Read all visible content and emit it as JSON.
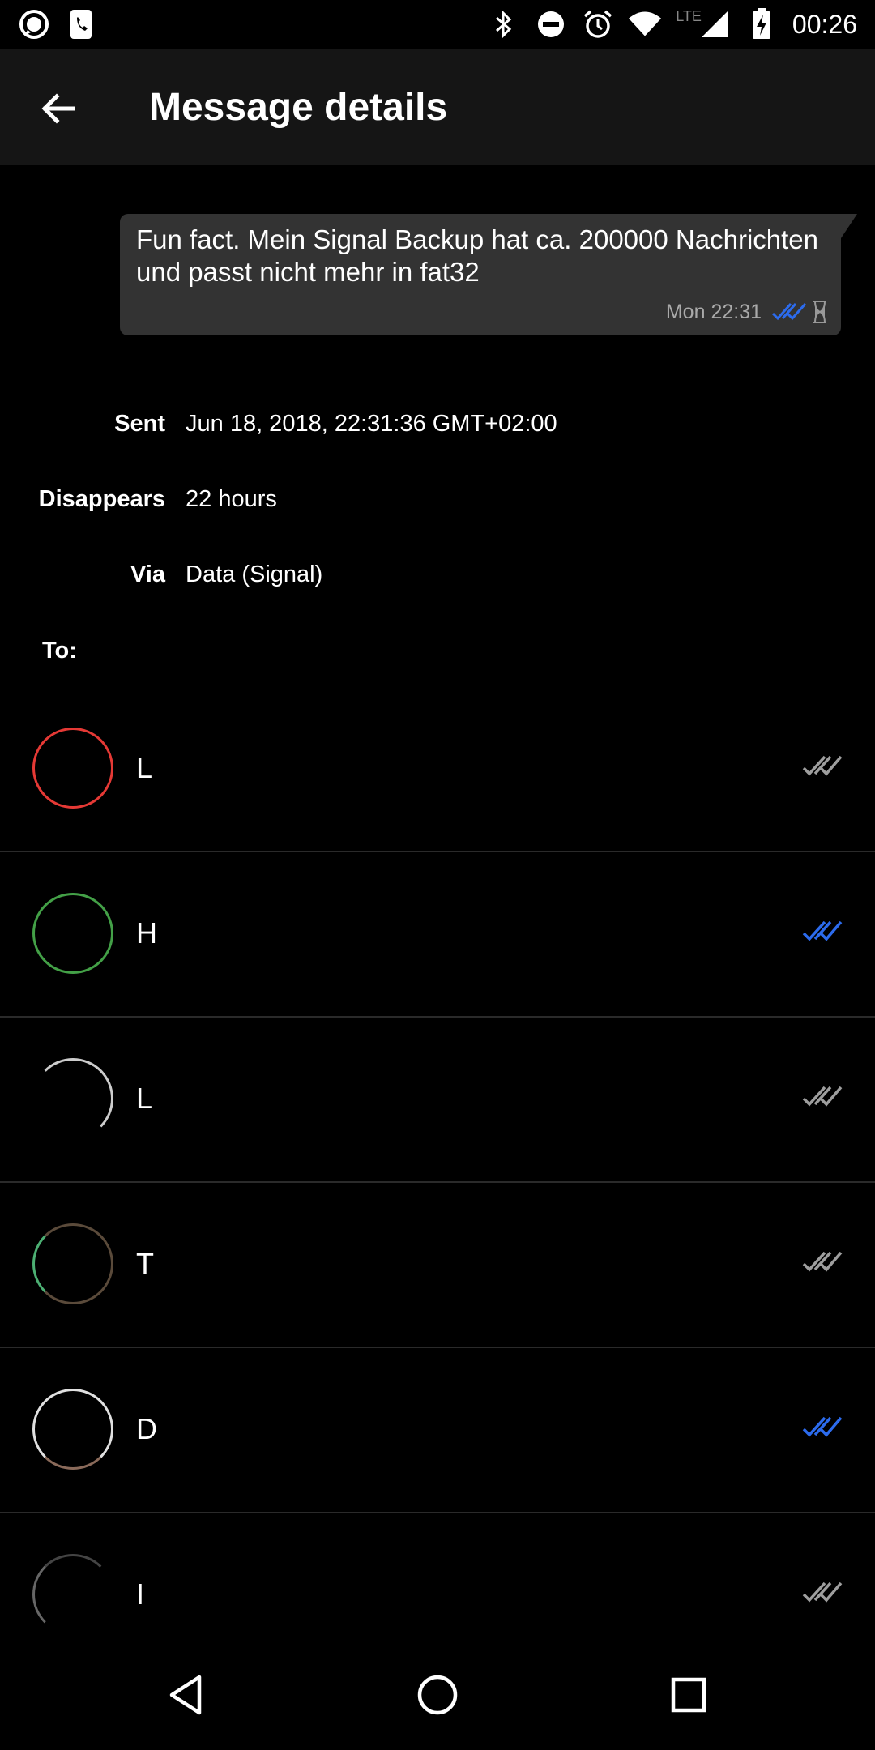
{
  "status_bar": {
    "time": "00:26",
    "network_label": "LTE",
    "left_icons": [
      "signal-app-icon",
      "phone-app-icon"
    ],
    "right_icons": [
      "bluetooth-icon",
      "do-not-disturb-icon",
      "alarm-icon",
      "wifi-icon",
      "cell-signal-icon",
      "battery-charging-icon"
    ]
  },
  "toolbar": {
    "title": "Message details",
    "back_icon": "arrow-left-icon"
  },
  "message": {
    "text": "Fun fact. Mein Signal Backup hat ca. 200000 Nachrichten und passt nicht mehr in fat32",
    "time": "Mon 22:31",
    "delivery_icon": "double-check-icon",
    "timer_icon": "hourglass-icon",
    "delivery_color": "#2c6bed"
  },
  "details": {
    "sent_label": "Sent",
    "sent_value": "Jun 18, 2018, 22:31:36 GMT+02:00",
    "disappears_label": "Disappears",
    "disappears_value": "22 hours",
    "via_label": "Via",
    "via_value": "Data (Signal)",
    "to_label": "To:"
  },
  "recipients": [
    {
      "name": "L",
      "avatar_color": "#e53935",
      "status": "delivered"
    },
    {
      "name": "H",
      "avatar_color": "#43a047",
      "status": "read"
    },
    {
      "name": "L",
      "avatar_color": "#cccccc",
      "status": "delivered"
    },
    {
      "name": "T",
      "avatar_color": "#4caf73",
      "status": "delivered"
    },
    {
      "name": "D",
      "avatar_color": "#e0e0e0",
      "status": "read"
    },
    {
      "name": "I",
      "avatar_color": "#666666",
      "status": "delivered"
    }
  ],
  "colors": {
    "read": "#2c6bed",
    "delivered": "#9e9e9e",
    "toolbar_bg": "#151515",
    "bubble_bg": "#333333"
  },
  "nav": {
    "back_icon": "triangle-back-icon",
    "home_icon": "circle-home-icon",
    "recents_icon": "square-recents-icon"
  }
}
